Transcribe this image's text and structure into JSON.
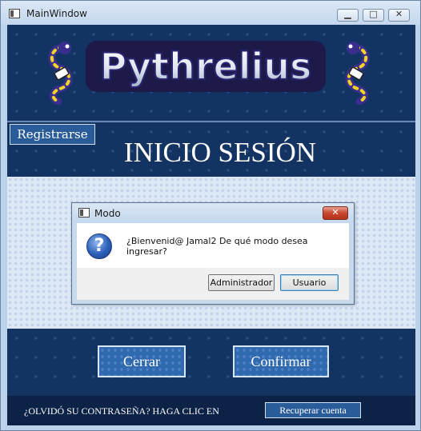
{
  "window": {
    "title": "MainWindow"
  },
  "banner": {
    "logo_text": "Pythrelius"
  },
  "header": {
    "register_label": "Registrarse",
    "page_title": "INICIO SESIÓN"
  },
  "dialog": {
    "title": "Modo",
    "message": "¿Bienvenid@ Jamal2 De qué modo desea ingresar?",
    "admin_label": "Administrador",
    "user_label": "Usuario"
  },
  "actions": {
    "close_label": "Cerrar",
    "confirm_label": "Confirmar"
  },
  "footer": {
    "forgot_text": "¿OLVIDÓ SU CONTRASEÑA? HAGA CLIC EN",
    "recover_label": "Recuperar cuenta"
  },
  "colors": {
    "background": "#133462",
    "accent": "#2a5c9a",
    "dialog_close": "#c7462f"
  }
}
